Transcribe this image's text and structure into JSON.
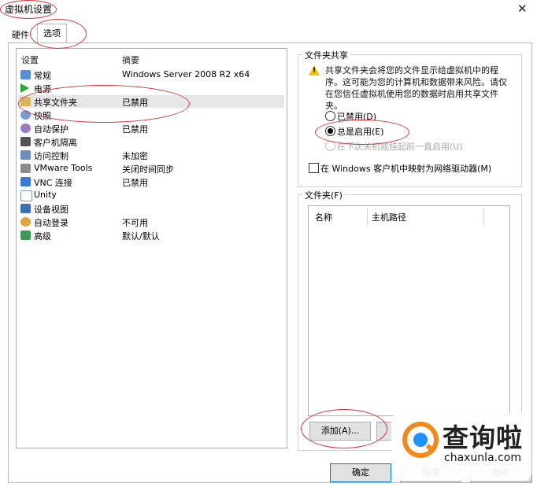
{
  "window": {
    "title": "虚拟机设置",
    "close_glyph": "✕"
  },
  "tabs": [
    {
      "label": "硬件",
      "active": false
    },
    {
      "label": "选项",
      "active": true
    }
  ],
  "settings": {
    "header_setting": "设置",
    "header_summary": "摘要",
    "items": [
      {
        "label": "常规",
        "summary": "Windows Server 2008 R2 x64",
        "icon": "general-icon",
        "selected": false
      },
      {
        "label": "电源",
        "summary": "",
        "icon": "power-icon",
        "selected": false
      },
      {
        "label": "共享文件夹",
        "summary": "已禁用",
        "icon": "shared-folder-icon",
        "selected": true
      },
      {
        "label": "快照",
        "summary": "",
        "icon": "snapshot-icon",
        "selected": false
      },
      {
        "label": "自动保护",
        "summary": "已禁用",
        "icon": "autoprotect-icon",
        "selected": false
      },
      {
        "label": "客户机隔离",
        "summary": "",
        "icon": "lock-icon",
        "selected": false
      },
      {
        "label": "访问控制",
        "summary": "未加密",
        "icon": "access-control-icon",
        "selected": false
      },
      {
        "label": "VMware Tools",
        "summary": "关闭时间同步",
        "icon": "vmware-tools-icon",
        "selected": false
      },
      {
        "label": "VNC 连接",
        "summary": "已禁用",
        "icon": "vnc-icon",
        "selected": false
      },
      {
        "label": "Unity",
        "summary": "",
        "icon": "unity-icon",
        "selected": false
      },
      {
        "label": "设备视图",
        "summary": "",
        "icon": "device-view-icon",
        "selected": false
      },
      {
        "label": "自动登录",
        "summary": "不可用",
        "icon": "autologin-icon",
        "selected": false
      },
      {
        "label": "高级",
        "summary": "默认/默认",
        "icon": "advanced-icon",
        "selected": false
      }
    ]
  },
  "folder_sharing": {
    "title": "文件夹共享",
    "warning_text": "共享文件夹会将您的文件显示给虚拟机中的程序。这可能为您的计算机和数据带来风险。请仅在您信任虚拟机使用您的数据时启用共享文件夹。",
    "warning_icon": "warning-icon",
    "options": [
      {
        "label": "已禁用(D)",
        "checked": false,
        "enabled": true
      },
      {
        "label": "总是启用(E)",
        "checked": true,
        "enabled": true
      },
      {
        "label": "在下次关机或挂起前一直启用(U)",
        "checked": false,
        "enabled": false
      }
    ],
    "map_drive_label": "在 Windows 客户机中映射为网络驱动器(M)"
  },
  "folders": {
    "title": "文件夹(F)",
    "col_name": "名称",
    "col_path": "主机路径",
    "add_button": "添加(A)..."
  },
  "footer": {
    "ok_button": "确定",
    "cancel_button": "取消",
    "help_button": "帮助"
  },
  "watermark": {
    "name": "查询啦",
    "domain": "chaxunla.com"
  },
  "colors": {
    "annotation": "#d9343a",
    "selection": "#e6e6e6",
    "default_button_border": "#0078d7",
    "watermark_orange": "#f08a1c",
    "watermark_blue": "#1e90ff"
  }
}
